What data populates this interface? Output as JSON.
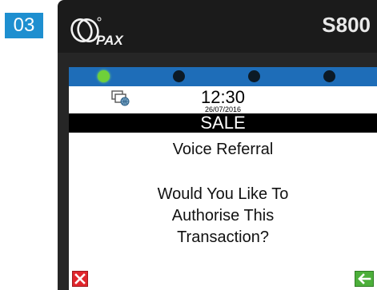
{
  "step": {
    "number": "03"
  },
  "device": {
    "brand": "PAX",
    "model": "S800"
  },
  "leds": [
    {
      "state": "on",
      "color": "#6fd03a"
    },
    {
      "state": "off",
      "color": "#0c1a26"
    },
    {
      "state": "off",
      "color": "#0c1a26"
    },
    {
      "state": "off",
      "color": "#0c1a26"
    }
  ],
  "status": {
    "time": "12:30",
    "date": "26/07/2016",
    "network_icon": "network-icon"
  },
  "screen": {
    "title": "SALE",
    "subtitle": "Voice Referral",
    "prompt_lines": [
      "Would You Like To",
      "Authorise This",
      "Transaction?"
    ]
  },
  "softkeys": {
    "cancel": {
      "icon": "cancel-x-icon",
      "color": "#e0262c"
    },
    "enter": {
      "icon": "arrow-left-icon",
      "color": "#4caf3a"
    }
  }
}
